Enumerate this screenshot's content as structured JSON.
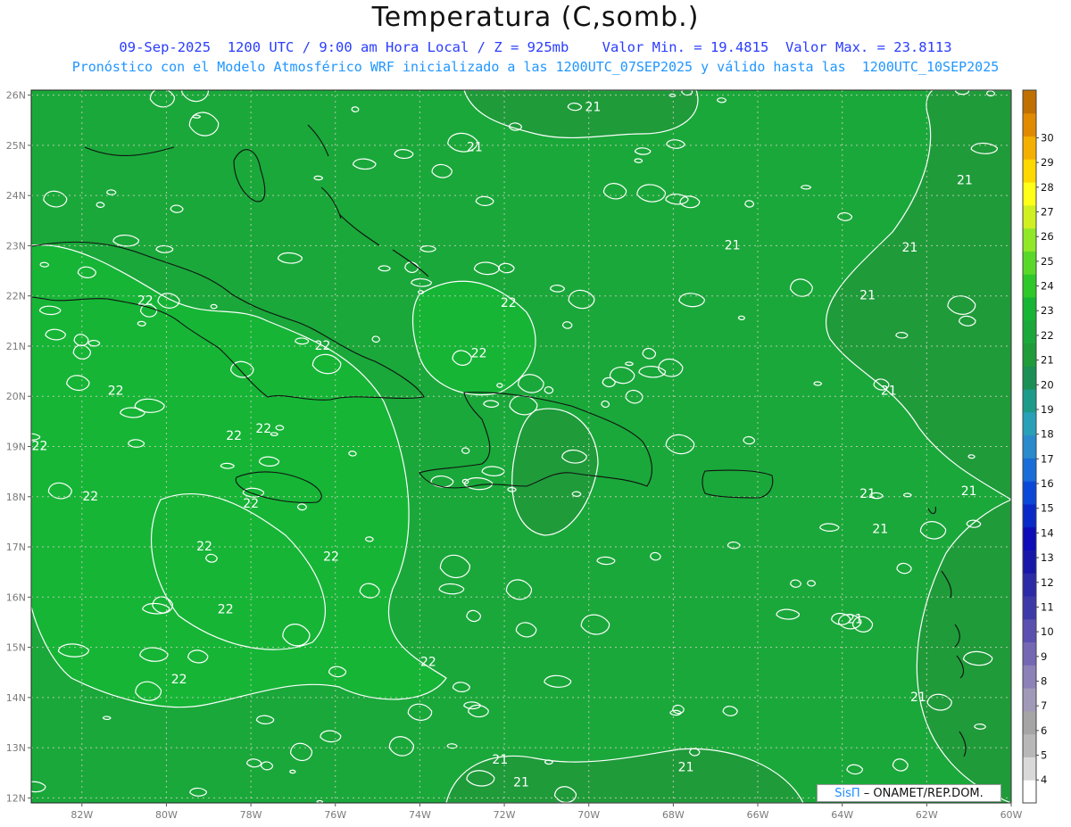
{
  "title": "Temperatura (C,somb.)",
  "subtitle_line1": "09-Sep-2025  1200 UTC / 9:00 am Hora Local / Z = 925mb    Valor Min. = 19.4815  Valor Max. = 23.8113",
  "subtitle_line2": "Pronóstico con el Modelo Atmosférico WRF inicializado a las 1200UTC_07SEP2025 y válido hasta las  1200UTC_10SEP2025",
  "credit": {
    "brand": "SisΠ",
    "org": " – ONAMET/REP.DOM."
  },
  "map": {
    "lon_range": [
      -83.2,
      -60
    ],
    "lat_range": [
      11.9,
      26.1
    ],
    "lon_ticks": [
      -82,
      -80,
      -78,
      -76,
      -74,
      -72,
      -70,
      -68,
      -66,
      -64,
      -62,
      -60
    ],
    "lon_tick_labels": [
      "82W",
      "80W",
      "78W",
      "76W",
      "74W",
      "72W",
      "70W",
      "68W",
      "66W",
      "64W",
      "62W",
      "60W"
    ],
    "lat_ticks": [
      12,
      13,
      14,
      15,
      16,
      17,
      18,
      19,
      20,
      21,
      22,
      23,
      24,
      25,
      26
    ],
    "lat_tick_labels": [
      "12N",
      "13N",
      "14N",
      "15N",
      "16N",
      "17N",
      "18N",
      "19N",
      "20N",
      "21N",
      "22N",
      "23N",
      "24N",
      "25N",
      "26N"
    ],
    "grid": true,
    "field_colors": {
      "c21": "#1f9b3a",
      "c22": "#1aa83a",
      "c23": "#16b536",
      "c20": "#1b8f55"
    },
    "contour_labels": [
      {
        "text": "21",
        "lon": -72.7,
        "lat": 24.95
      },
      {
        "text": "21",
        "lon": -69.9,
        "lat": 25.75
      },
      {
        "text": "21",
        "lon": -61.1,
        "lat": 24.3
      },
      {
        "text": "21",
        "lon": -66.6,
        "lat": 23.0
      },
      {
        "text": "21",
        "lon": -62.4,
        "lat": 22.95
      },
      {
        "text": "21",
        "lon": -63.4,
        "lat": 22.0
      },
      {
        "text": "22",
        "lon": -71.9,
        "lat": 21.85
      },
      {
        "text": "22",
        "lon": -80.5,
        "lat": 21.9
      },
      {
        "text": "22",
        "lon": -76.3,
        "lat": 21.0
      },
      {
        "text": "22",
        "lon": -72.6,
        "lat": 20.85
      },
      {
        "text": "22",
        "lon": -81.2,
        "lat": 20.1
      },
      {
        "text": "21",
        "lon": -62.9,
        "lat": 20.1
      },
      {
        "text": "22",
        "lon": -78.4,
        "lat": 19.2
      },
      {
        "text": "22",
        "lon": -77.7,
        "lat": 19.35
      },
      {
        "text": "22",
        "lon": -83.0,
        "lat": 19.0
      },
      {
        "text": "22",
        "lon": -81.8,
        "lat": 18.0
      },
      {
        "text": "22",
        "lon": -78.0,
        "lat": 17.85
      },
      {
        "text": "21",
        "lon": -63.4,
        "lat": 18.05
      },
      {
        "text": "21",
        "lon": -61.0,
        "lat": 18.1
      },
      {
        "text": "21",
        "lon": -63.1,
        "lat": 17.35
      },
      {
        "text": "22",
        "lon": -79.1,
        "lat": 17.0
      },
      {
        "text": "22",
        "lon": -76.1,
        "lat": 16.8
      },
      {
        "text": "22",
        "lon": -78.6,
        "lat": 15.75
      },
      {
        "text": "21",
        "lon": -63.7,
        "lat": 15.55
      },
      {
        "text": "22",
        "lon": -73.8,
        "lat": 14.7
      },
      {
        "text": "22",
        "lon": -79.7,
        "lat": 14.35
      },
      {
        "text": "21",
        "lon": -62.2,
        "lat": 14.0
      },
      {
        "text": "21",
        "lon": -72.1,
        "lat": 12.75
      },
      {
        "text": "21",
        "lon": -67.7,
        "lat": 12.6
      },
      {
        "text": "21",
        "lon": -71.6,
        "lat": 12.3
      }
    ]
  },
  "colorbar": {
    "labels": [
      "4",
      "5",
      "6",
      "7",
      "8",
      "9",
      "10",
      "11",
      "12",
      "13",
      "14",
      "15",
      "16",
      "17",
      "18",
      "19",
      "20",
      "21",
      "22",
      "23",
      "24",
      "25",
      "26",
      "27",
      "28",
      "29",
      "30"
    ],
    "colors": [
      "#ffffff",
      "#d9d9d9",
      "#b8b8b8",
      "#a5a5a5",
      "#a09ab8",
      "#8c82b8",
      "#7468b4",
      "#5a50b0",
      "#3d3aa8",
      "#2b2ba8",
      "#1818a8",
      "#0c0cb8",
      "#0a28c8",
      "#0c48d8",
      "#1a6cd8",
      "#2a8acc",
      "#2aa0b8",
      "#1e9a8a",
      "#1b8f55",
      "#1f9b3a",
      "#1aa83a",
      "#16b536",
      "#2ec82a",
      "#5ad82a",
      "#90e828",
      "#d0f020",
      "#ffff18",
      "#ffd800",
      "#f4b000",
      "#e08a00",
      "#c07000"
    ]
  }
}
